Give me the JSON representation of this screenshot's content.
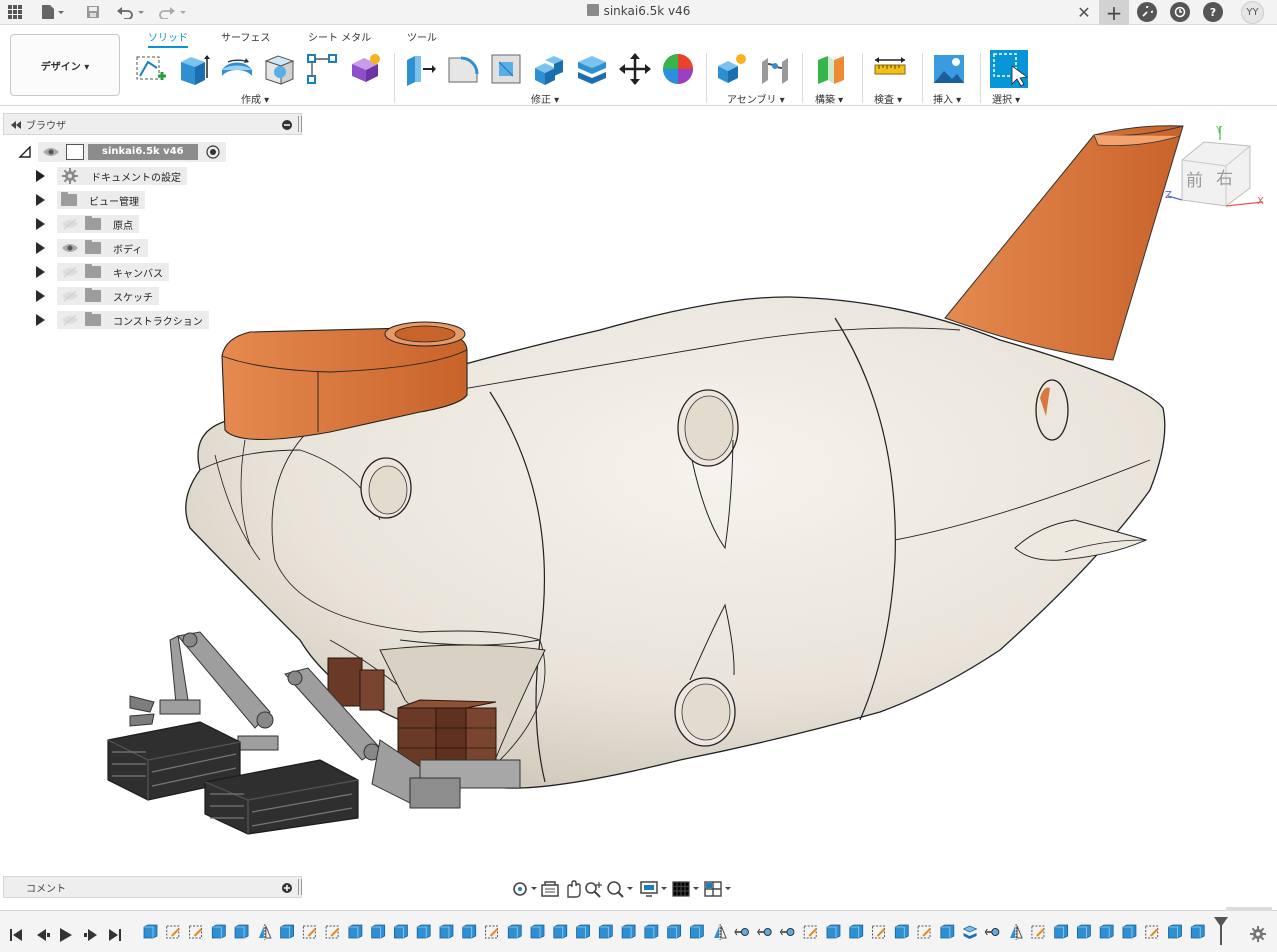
{
  "titlebar": {
    "document_title": "sinkai6.5k v46",
    "avatar_initials": "YY",
    "icons": [
      "grid-icon",
      "file-icon",
      "save-icon",
      "undo-icon",
      "redo-icon",
      "close-tab-icon",
      "new-tab-icon",
      "extensions-icon",
      "job-status-icon",
      "help-icon"
    ]
  },
  "ribbon": {
    "workspace_label": "デザイン ▾",
    "tabs": [
      {
        "label": "ソリッド",
        "active": true
      },
      {
        "label": "サーフェス",
        "active": false
      },
      {
        "label": "シート メタル",
        "active": false
      },
      {
        "label": "ツール",
        "active": false
      }
    ],
    "groups": [
      {
        "label": "作成 ▾"
      },
      {
        "label": "修正 ▾"
      },
      {
        "label": "アセンブリ ▾"
      },
      {
        "label": "構築 ▾"
      },
      {
        "label": "検査 ▾"
      },
      {
        "label": "挿入 ▾"
      },
      {
        "label": "選択 ▾"
      }
    ]
  },
  "browser": {
    "title": "ブラウザ",
    "root": {
      "label": "sinkai6.5k v46"
    },
    "items": [
      {
        "label": "ドキュメントの設定",
        "icon": "gear-icon",
        "visible": null
      },
      {
        "label": "ビュー管理",
        "icon": "folder-icon",
        "visible": null
      },
      {
        "label": "原点",
        "icon": "folder-icon",
        "visible": false
      },
      {
        "label": "ボディ",
        "icon": "folder-icon",
        "visible": true
      },
      {
        "label": "キャンバス",
        "icon": "folder-icon",
        "visible": false
      },
      {
        "label": "スケッチ",
        "icon": "folder-icon",
        "visible": false
      },
      {
        "label": "コンストラクション",
        "icon": "folder-icon",
        "visible": false
      }
    ]
  },
  "viewcube": {
    "front_label": "前",
    "right_label": "右",
    "axis_x": "X",
    "axis_y": "Y",
    "axis_z": "Z"
  },
  "comments": {
    "title": "コメント"
  },
  "colors": {
    "accent": "#0696d7",
    "hull": "#e9e3d8",
    "fin_orange": "#d8773e",
    "crate": "#6b3a26"
  }
}
